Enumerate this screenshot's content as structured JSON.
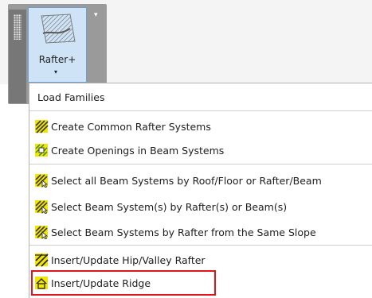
{
  "ribbon": {
    "button_label": "Rafter+",
    "caret": "▾",
    "panel_caret": "▾"
  },
  "menu": {
    "items": [
      {
        "label": "Load Families",
        "icon": ""
      },
      {
        "label": "Create Common Rafter Systems",
        "icon": "rafter-system-icon"
      },
      {
        "label": "Create Openings in Beam Systems",
        "icon": "beam-opening-icon"
      },
      {
        "label": "Select all Beam Systems by Roof/Floor or Rafter/Beam",
        "icon": "beam-select-icon"
      },
      {
        "label": "Select Beam System(s) by Rafter(s) or Beam(s)",
        "icon": "beam-select-icon"
      },
      {
        "label": "Select Beam Systems by Rafter from the Same Slope",
        "icon": "beam-select-icon"
      },
      {
        "label": "Insert/Update Hip/Valley Rafter",
        "icon": "hip-valley-icon"
      },
      {
        "label": "Insert/Update Ridge",
        "icon": "ridge-icon"
      }
    ]
  },
  "colors": {
    "button_bg": "#cfe3f7",
    "highlight_border": "#e2141b",
    "icon_yellow": "#f2e500"
  }
}
